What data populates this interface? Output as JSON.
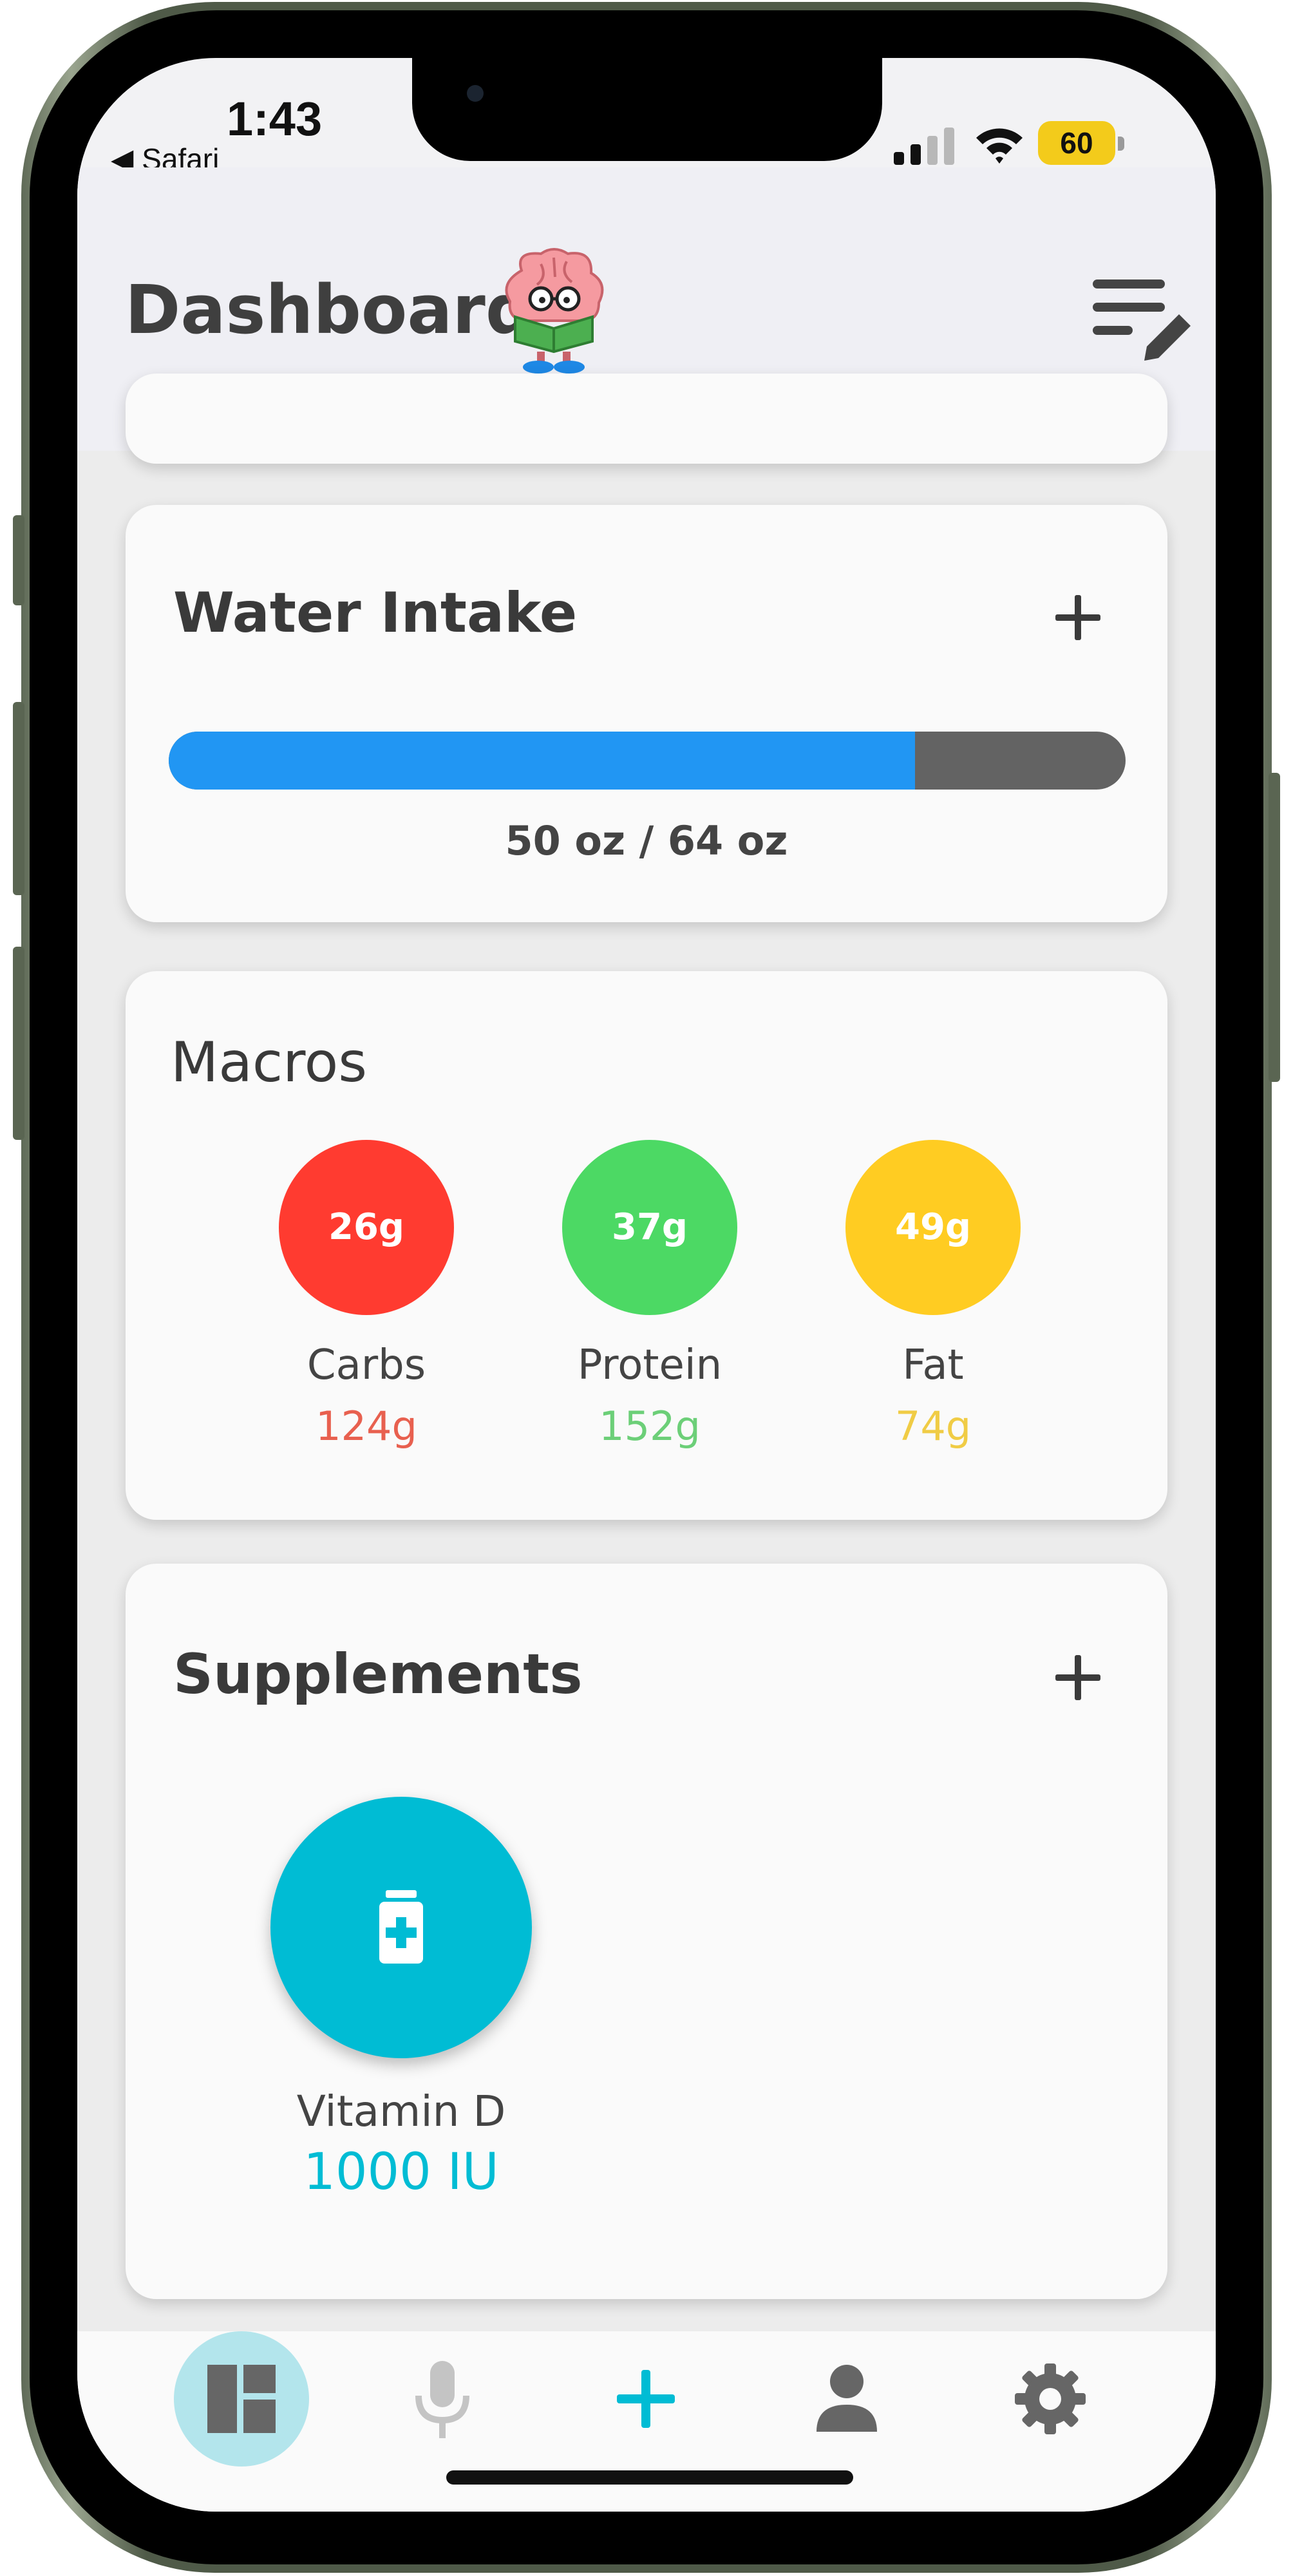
{
  "status_bar": {
    "time": "1:43",
    "back_app": "◀ Safari",
    "battery": "60"
  },
  "header": {
    "title": "Dashboard",
    "mascot_icon": "brain-reading-book-mascot",
    "menu_icon": "list-edit-icon"
  },
  "water": {
    "title": "Water Intake",
    "progress_fraction": 0.78,
    "text": "50 oz / 64 oz",
    "colors": {
      "fill": "#2196f3",
      "track": "#636363"
    }
  },
  "macros": {
    "title": "Macros",
    "items": [
      {
        "value": "26g",
        "label": "Carbs",
        "goal": "124g",
        "color": "#ff3b30",
        "goal_color": "#e8604f"
      },
      {
        "value": "37g",
        "label": "Protein",
        "goal": "152g",
        "color": "#4cd964",
        "goal_color": "#6ccf78"
      },
      {
        "value": "49g",
        "label": "Fat",
        "goal": "74g",
        "color": "#ffcc22",
        "goal_color": "#f0cc45"
      }
    ]
  },
  "supplements": {
    "title": "Supplements",
    "items": [
      {
        "name": "Vitamin D",
        "dose": "1000 IU",
        "icon": "supplement-bottle-icon",
        "color": "#00bcd4"
      }
    ]
  },
  "nav": {
    "items": [
      {
        "icon": "dashboard-icon",
        "active": true
      },
      {
        "icon": "microphone-icon",
        "active": false
      },
      {
        "icon": "plus-icon",
        "active": false
      },
      {
        "icon": "person-icon",
        "active": false
      },
      {
        "icon": "gear-icon",
        "active": false
      }
    ],
    "accent": "#00bcd4"
  }
}
